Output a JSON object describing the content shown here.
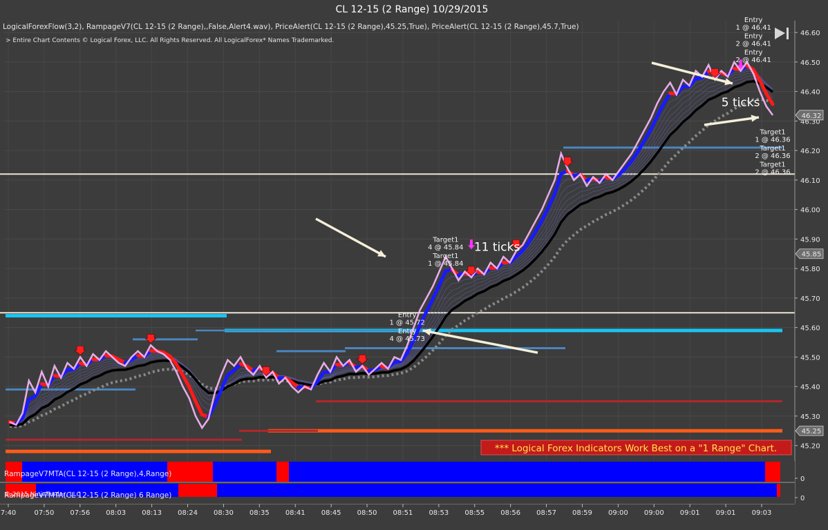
{
  "title": "CL 12-15 (2 Range)  10/29/2015",
  "indicator_header": "LogicalForexFlow(3,2), RampageV7(CL 12-15 (2 Range),,False,Alert4.wav), PriceAlert(CL 12-15 (2 Range),45.25,True), PriceAlert(CL 12-15 (2 Range),45.7,True)",
  "copyright_note": "> Entire Chart Contents © Logical Forex, LLC. All Rights Reserved. All LogicalForex* Names Trademarked.",
  "banner": "*** Logical Forex Indicators Work Best on a \"1 Range\" Chart.",
  "panel1_label": "RampageV7MTA(CL 12-15 (2 Range),4,Range)",
  "panel2_label": "RampageV7MTA(CL 12-15 (2 Range) 6 Range)",
  "panel2_overlay": "© 2015 NinjaTrader, LLC",
  "panel_zero": "0",
  "colors": {
    "background": "#3c3c3c",
    "rampage_up": "#1a1aff",
    "rampage_down": "#ff1a1a",
    "price": "#ff88ff",
    "alert_line": "#ece6d6",
    "cyan": "#19c4f2",
    "steel": "#4a86c0",
    "dark_red": "#b3262b",
    "orange": "#ff5a1a",
    "banner_bg": "#c41a1a",
    "banner_text": "#ffe44d",
    "panel_blue": "#0000ff",
    "panel_red": "#ff0000"
  },
  "chart_data": {
    "type": "line",
    "title": "CL 12-15 (2 Range)  10/29/2015",
    "xlabel": "",
    "ylabel": "",
    "ylim": [
      45.15,
      46.64
    ],
    "y_ticks": [
      "46.60",
      "46.50",
      "46.40",
      "46.30",
      "46.20",
      "46.10",
      "46.00",
      "45.90",
      "45.80",
      "45.70",
      "45.60",
      "45.50",
      "45.40",
      "45.30",
      "45.20"
    ],
    "x_ticks": [
      "7:40",
      "07:50",
      "07:56",
      "08:03",
      "08:13",
      "08:24",
      "08:30",
      "08:35",
      "08:41",
      "08:45",
      "08:50",
      "08:51",
      "08:53",
      "08:55",
      "08:56",
      "08:57",
      "08:59",
      "09:00",
      "09:00",
      "09:01",
      "09:01",
      "09:03"
    ],
    "grid": true,
    "price_markers": [
      {
        "label": "46.32",
        "value": 46.32,
        "style": "grey"
      },
      {
        "label": "45.85",
        "value": 45.85,
        "style": "grey"
      },
      {
        "label": "45.25",
        "value": 45.25,
        "style": "grey"
      }
    ],
    "alert_lines": [
      46.12,
      45.65
    ],
    "series": [
      {
        "name": "",
        "values": [
          45.28,
          45.27,
          45.31,
          45.42,
          45.38,
          45.45,
          45.4,
          45.47,
          45.43,
          45.48,
          45.46,
          45.5,
          45.47,
          45.51,
          45.49,
          45.52,
          45.5,
          45.48,
          45.47,
          45.5,
          45.52,
          45.5,
          45.54,
          45.52,
          45.51,
          45.49,
          45.45,
          45.4,
          45.36,
          45.3,
          45.26,
          45.29,
          45.38,
          45.44,
          45.49,
          45.47,
          45.5,
          45.46,
          45.44,
          45.47,
          45.43,
          45.45,
          45.41,
          45.43,
          45.4,
          45.38,
          45.4,
          45.39,
          45.44,
          45.48,
          45.45,
          45.5,
          45.47,
          45.49,
          45.45,
          45.47,
          45.44,
          45.46,
          45.48,
          45.46,
          45.5,
          45.49,
          45.54,
          45.6,
          45.66,
          45.7,
          45.74,
          45.79,
          45.84,
          45.8,
          45.76,
          45.79,
          45.77,
          45.8,
          45.78,
          45.82,
          45.8,
          45.84,
          45.82,
          45.86,
          45.88,
          45.92,
          45.96,
          46.0,
          46.05,
          46.1,
          46.19,
          46.14,
          46.1,
          46.12,
          46.08,
          46.11,
          46.09,
          46.12,
          46.1,
          46.13,
          46.16,
          46.19,
          46.23,
          46.27,
          46.31,
          46.36,
          46.4,
          46.43,
          46.39,
          46.44,
          46.42,
          46.47,
          46.45,
          46.49,
          46.44,
          46.47,
          46.45,
          46.5,
          46.47,
          46.5,
          46.46,
          46.4,
          46.35,
          46.32
        ]
      }
    ],
    "annotations": [
      {
        "text": "Target1",
        "x_index": 68,
        "y": 45.89
      },
      {
        "text": "4 @ 45.84",
        "x_index": 68,
        "y": 45.865
      },
      {
        "text": "Target1",
        "x_index": 68,
        "y": 45.835
      },
      {
        "text": "1 @ 45.84",
        "x_index": 68,
        "y": 45.81
      },
      {
        "text": "11 ticks",
        "x_index": 76,
        "y": 45.86
      },
      {
        "text": "Entry",
        "x_index": 62,
        "y": 45.635
      },
      {
        "text": "1 @ 45.72",
        "x_index": 62,
        "y": 45.61
      },
      {
        "text": "Entry",
        "x_index": 62,
        "y": 45.58
      },
      {
        "text": "4 @ 45.73",
        "x_index": 62,
        "y": 45.555
      },
      {
        "text": "Entry",
        "x_index": 116,
        "y": 46.635
      },
      {
        "text": "1 @ 46.41",
        "x_index": 116,
        "y": 46.61
      },
      {
        "text": "Entry",
        "x_index": 116,
        "y": 46.58
      },
      {
        "text": "2 @ 46.41",
        "x_index": 116,
        "y": 46.555
      },
      {
        "text": "Entry",
        "x_index": 116,
        "y": 46.525
      },
      {
        "text": "2 @ 46.41",
        "x_index": 116,
        "y": 46.5
      },
      {
        "text": "5 ticks",
        "x_index": 114,
        "y": 46.35
      },
      {
        "text": "Target1",
        "x_index": 119,
        "y": 46.255
      },
      {
        "text": "1 @ 46.36",
        "x_index": 119,
        "y": 46.23
      },
      {
        "text": "Target1",
        "x_index": 119,
        "y": 46.2
      },
      {
        "text": "2 @ 46.36",
        "x_index": 119,
        "y": 46.175
      },
      {
        "text": "Target1",
        "x_index": 119,
        "y": 46.145
      },
      {
        "text": "2 @ 46.36",
        "x_index": 119,
        "y": 46.12
      }
    ]
  }
}
